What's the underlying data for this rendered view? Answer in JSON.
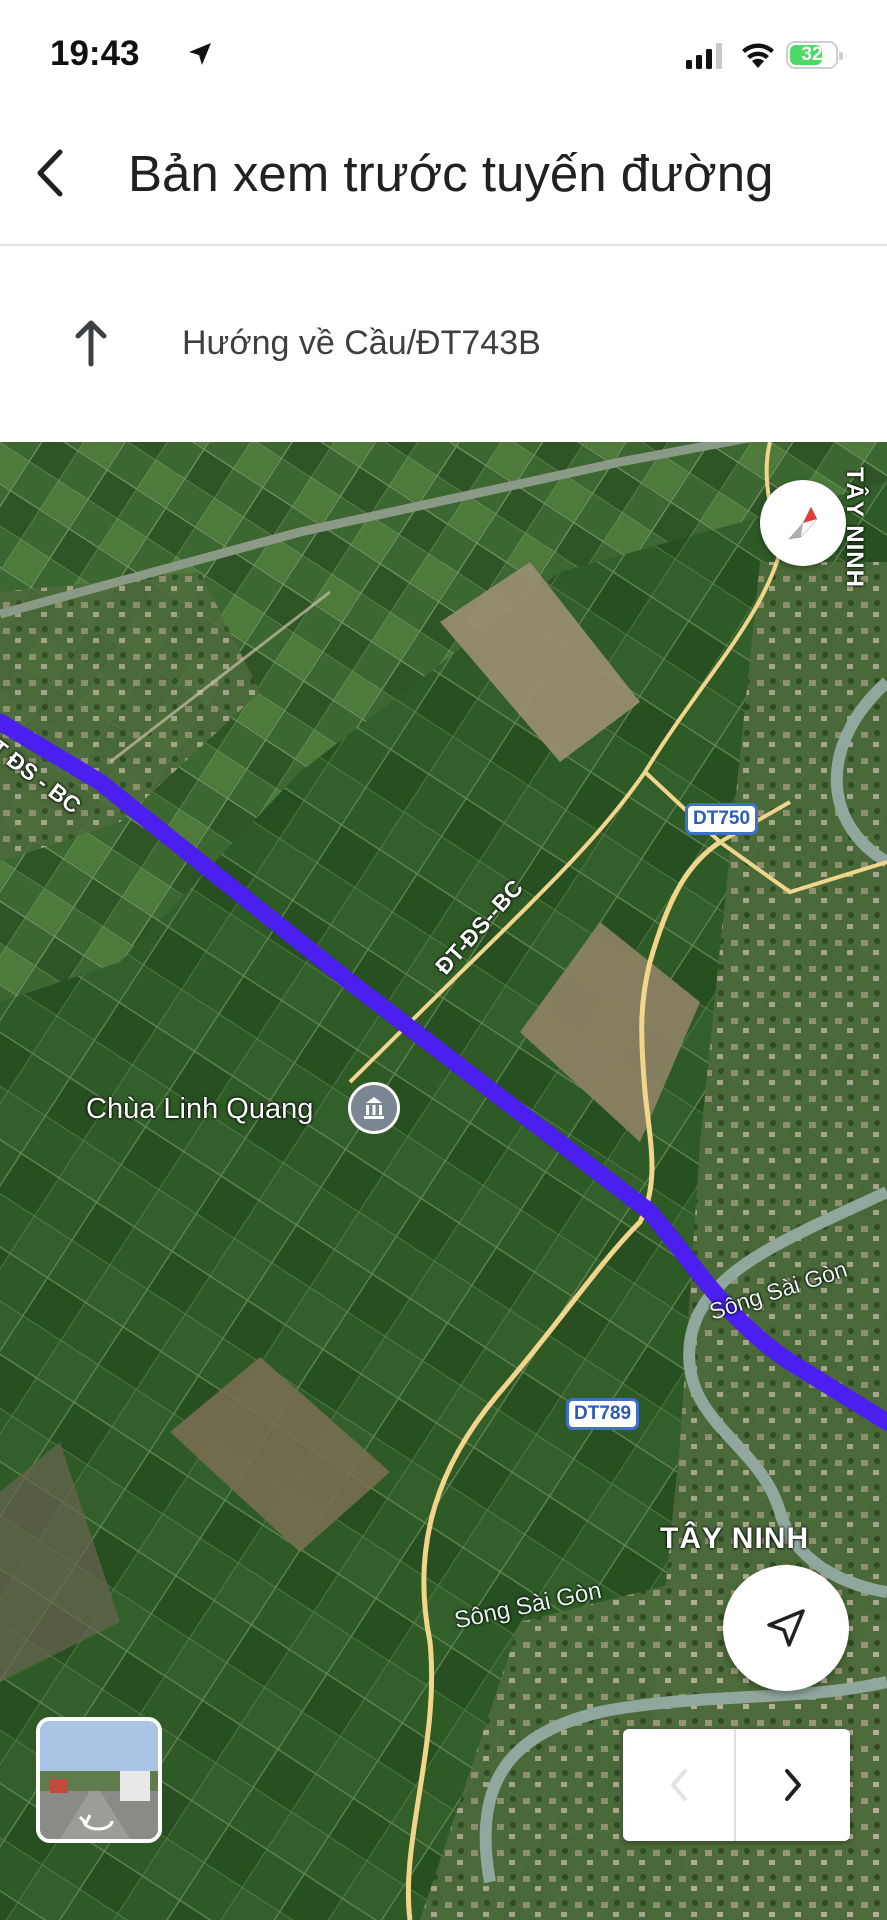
{
  "status_bar": {
    "time": "19:43",
    "battery": "32"
  },
  "header": {
    "title": "Bản xem trước tuyến đường"
  },
  "step": {
    "instruction": "Hướng về Cầu/ĐT743B"
  },
  "map": {
    "place_label": "Chùa Linh Quang",
    "road_labels": [
      "ĐT ĐS - BC",
      "ĐT-ĐS--BC"
    ],
    "route_shields": [
      "DT750",
      "DT789"
    ],
    "area_labels": [
      "TÂY NINH",
      "TÂY NINH"
    ],
    "river_labels": [
      "Sông Sài Gòn",
      "Sông Sài Gòn"
    ],
    "route_color": "#4a1ff0",
    "road_color": "#f1d58a"
  },
  "icons": {
    "back": "chevron-left-icon",
    "step": "arrow-up-icon",
    "compass": "compass-icon",
    "locate": "navigation-arrow-icon",
    "prev": "chevron-left-icon",
    "next": "chevron-right-icon",
    "place": "temple-icon"
  }
}
